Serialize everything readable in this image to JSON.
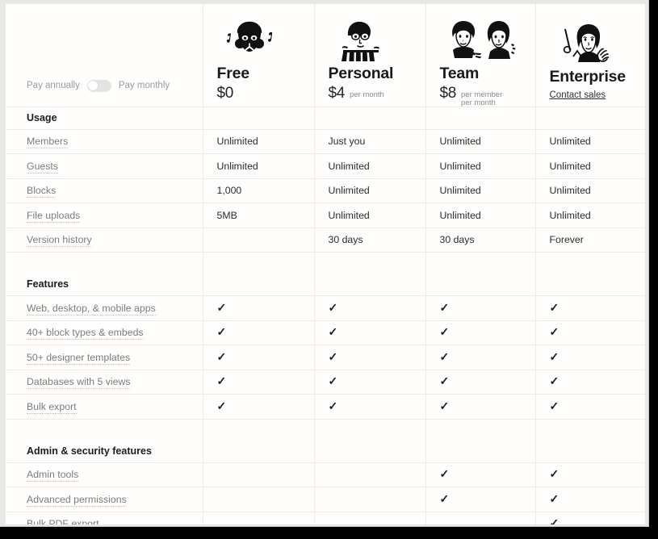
{
  "billing_toggle": {
    "annual_label": "Pay annually",
    "monthly_label": "Pay monthly",
    "selected": "annually"
  },
  "plans": [
    {
      "name": "Free",
      "price": "$0",
      "price_note": "",
      "cta": "",
      "icon": "person-headphones-icon"
    },
    {
      "name": "Personal",
      "price": "$4",
      "price_note": "per month",
      "cta": "",
      "icon": "person-typing-icon"
    },
    {
      "name": "Team",
      "price": "$8",
      "price_note": "per member\nper month",
      "cta": "",
      "icon": "two-people-icon"
    },
    {
      "name": "Enterprise",
      "price": "",
      "price_note": "",
      "cta": "Contact sales",
      "icon": "person-presenting-icon"
    }
  ],
  "sections": [
    {
      "title": "Usage",
      "rows": [
        {
          "label": "Members",
          "values": [
            "Unlimited",
            "Just you",
            "Unlimited",
            "Unlimited"
          ]
        },
        {
          "label": "Guests",
          "values": [
            "Unlimited",
            "Unlimited",
            "Unlimited",
            "Unlimited"
          ]
        },
        {
          "label": "Blocks",
          "values": [
            "1,000",
            "Unlimited",
            "Unlimited",
            "Unlimited"
          ]
        },
        {
          "label": "File uploads",
          "values": [
            "5MB",
            "Unlimited",
            "Unlimited",
            "Unlimited"
          ]
        },
        {
          "label": "Version history",
          "values": [
            "",
            "30 days",
            "30 days",
            "Forever"
          ]
        }
      ]
    },
    {
      "title": "Features",
      "rows": [
        {
          "label": "Web, desktop, & mobile apps",
          "values": [
            "✓",
            "✓",
            "✓",
            "✓"
          ]
        },
        {
          "label": "40+ block types & embeds",
          "values": [
            "✓",
            "✓",
            "✓",
            "✓"
          ]
        },
        {
          "label": "50+ designer templates",
          "values": [
            "✓",
            "✓",
            "✓",
            "✓"
          ]
        },
        {
          "label": "Databases with 5 views",
          "values": [
            "✓",
            "✓",
            "✓",
            "✓"
          ]
        },
        {
          "label": "Bulk export",
          "values": [
            "✓",
            "✓",
            "✓",
            "✓"
          ]
        }
      ]
    },
    {
      "title": "Admin & security features",
      "rows": [
        {
          "label": "Admin tools",
          "values": [
            "",
            "",
            "✓",
            "✓"
          ]
        },
        {
          "label": "Advanced permissions",
          "values": [
            "",
            "",
            "✓",
            "✓"
          ]
        },
        {
          "label": "Bulk PDF export",
          "values": [
            "",
            "",
            "",
            "✓"
          ]
        }
      ]
    }
  ],
  "colors": {
    "text_primary": "#1c1c1c",
    "text_secondary": "#7c7c7c",
    "border": "#eeecea",
    "background": "#fffefc"
  }
}
